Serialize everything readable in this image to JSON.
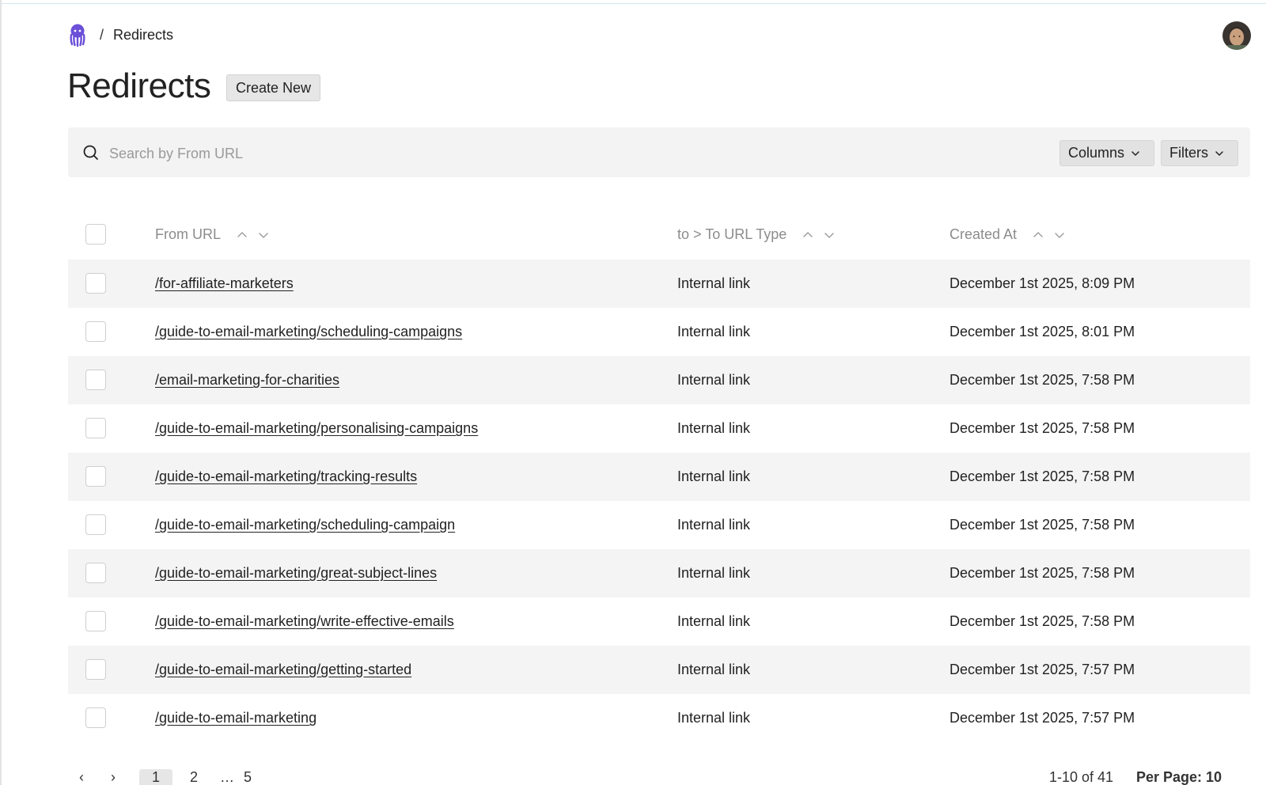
{
  "breadcrumb": {
    "separator": "/",
    "current": "Redirects"
  },
  "header": {
    "title": "Redirects",
    "create_label": "Create New"
  },
  "search": {
    "placeholder": "Search by From URL"
  },
  "toolbar": {
    "columns_label": "Columns",
    "filters_label": "Filters"
  },
  "table": {
    "headers": {
      "from": "From URL",
      "type": "to > To URL Type",
      "created": "Created At"
    },
    "rows": [
      {
        "from": "/for-affiliate-marketers",
        "type": "Internal link",
        "created": "December 1st 2025, 8:09 PM"
      },
      {
        "from": "/guide-to-email-marketing/scheduling-campaigns",
        "type": "Internal link",
        "created": "December 1st 2025, 8:01 PM"
      },
      {
        "from": "/email-marketing-for-charities",
        "type": "Internal link",
        "created": "December 1st 2025, 7:58 PM"
      },
      {
        "from": "/guide-to-email-marketing/personalising-campaigns",
        "type": "Internal link",
        "created": "December 1st 2025, 7:58 PM"
      },
      {
        "from": "/guide-to-email-marketing/tracking-results",
        "type": "Internal link",
        "created": "December 1st 2025, 7:58 PM"
      },
      {
        "from": "/guide-to-email-marketing/scheduling-campaign",
        "type": "Internal link",
        "created": "December 1st 2025, 7:58 PM"
      },
      {
        "from": "/guide-to-email-marketing/great-subject-lines",
        "type": "Internal link",
        "created": "December 1st 2025, 7:58 PM"
      },
      {
        "from": "/guide-to-email-marketing/write-effective-emails",
        "type": "Internal link",
        "created": "December 1st 2025, 7:58 PM"
      },
      {
        "from": "/guide-to-email-marketing/getting-started",
        "type": "Internal link",
        "created": "December 1st 2025, 7:57 PM"
      },
      {
        "from": "/guide-to-email-marketing",
        "type": "Internal link",
        "created": "December 1st 2025, 7:57 PM"
      }
    ]
  },
  "pagination": {
    "prev": "‹",
    "next": "›",
    "pages": [
      "1",
      "2",
      "…",
      "5"
    ],
    "range": "1-10 of 41",
    "per_page": "Per Page: 10"
  },
  "colors": {
    "accent": "#6b4fd8",
    "row_alt": "#f4f4f4",
    "button_bg": "#e6e6e6"
  },
  "icons": {
    "logo": "octopus-logo-icon",
    "search": "search-icon",
    "chevron": "chevron-down-icon",
    "sort_up": "sort-asc-icon",
    "sort_down": "sort-desc-icon"
  }
}
